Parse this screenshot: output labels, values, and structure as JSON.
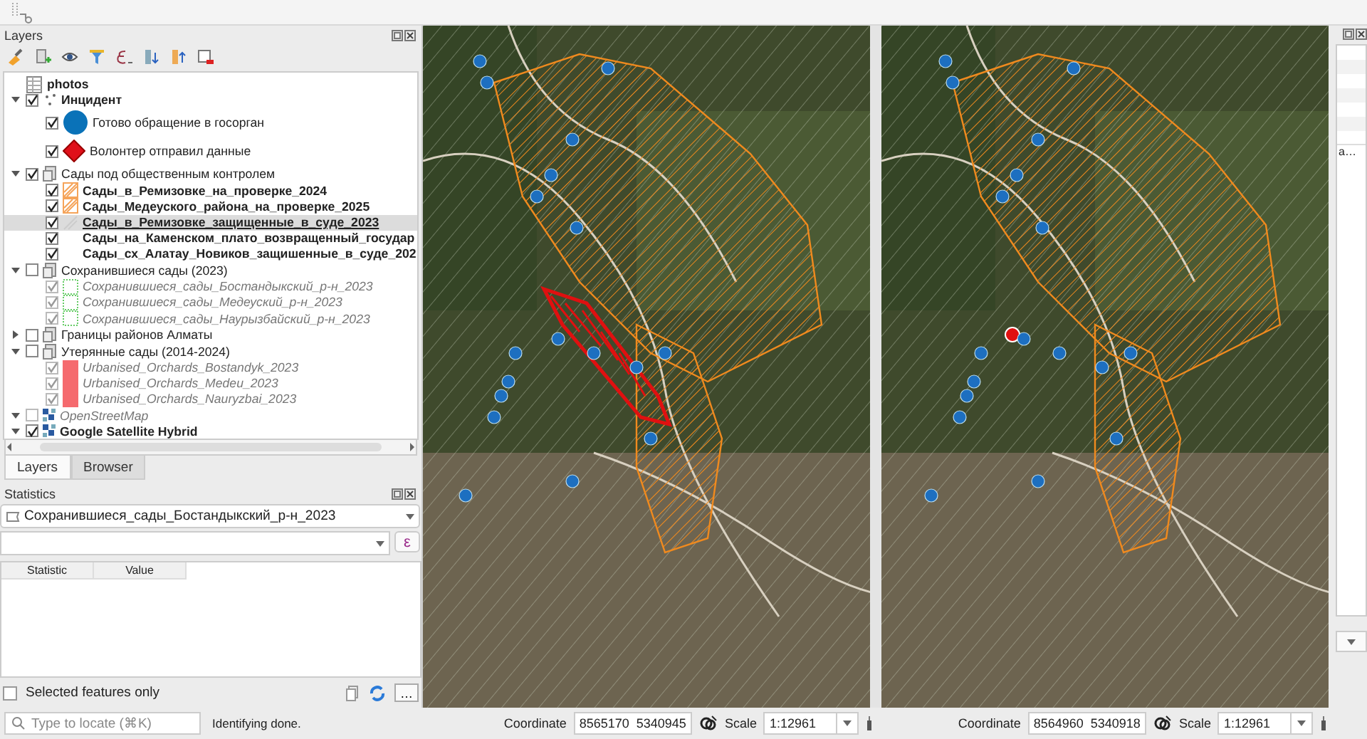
{
  "layers_panel": {
    "title": "Layers",
    "tree": [
      {
        "label": "photos",
        "kind": "table",
        "selected": false,
        "greyed": false
      },
      {
        "label": "Инцидент",
        "kind": "points",
        "checked": true,
        "expanded": true,
        "selected": false,
        "greyed": false,
        "children": [
          {
            "label": "Готово обращение в госорган",
            "kind": "circle",
            "checked": true,
            "selected": false,
            "greyed": false
          },
          {
            "label": "Волонтер отправил данные",
            "kind": "diamond",
            "checked": true,
            "selected": false,
            "greyed": false
          }
        ]
      },
      {
        "label": "Сады под общественным контролем",
        "kind": "group",
        "checked": true,
        "expanded": true,
        "selected": false,
        "greyed": false,
        "children": [
          {
            "label": "Сады_в_Ремизовке_на_проверке_2024",
            "kind": "hatched",
            "checked": true,
            "selected": false,
            "greyed": false
          },
          {
            "label": "Сады_Медеуского_района_на_проверке_2025",
            "kind": "hatched",
            "checked": true,
            "selected": false,
            "greyed": false
          },
          {
            "label": "Сады_в_Ремизовке_защищенные_в_суде_2023",
            "kind": "faint",
            "checked": true,
            "selected": true,
            "greyed": false
          },
          {
            "label": "Сады_на_Каменском_плато_возвращенный_государ",
            "kind": "blank",
            "checked": true,
            "selected": false,
            "greyed": false
          },
          {
            "label": "Сады_сх_Алатау_Новиков_защишенные_в_суде_202",
            "kind": "blank",
            "checked": true,
            "selected": false,
            "greyed": false
          }
        ]
      },
      {
        "label": "Сохранившиеся сады (2023)",
        "kind": "group",
        "checked": false,
        "expanded": true,
        "selected": false,
        "greyed": false,
        "children": [
          {
            "label": "Сохранившиеся_сады_Бостандыкский_р-н_2023",
            "kind": "outline",
            "checked": true,
            "selected": false,
            "greyed": true
          },
          {
            "label": "Сохранившиеся_сады_Медеуский_р-н_2023",
            "kind": "outline",
            "checked": true,
            "selected": false,
            "greyed": true
          },
          {
            "label": "Сохранившиеся_сады_Наурызбайский_р-н_2023",
            "kind": "outline",
            "checked": true,
            "selected": false,
            "greyed": true
          }
        ]
      },
      {
        "label": "Границы районов Алматы",
        "kind": "group",
        "checked": false,
        "expanded": false,
        "selected": false,
        "greyed": false
      },
      {
        "label": "Утерянные сады (2014-2024)",
        "kind": "group",
        "checked": false,
        "expanded": true,
        "selected": false,
        "greyed": false,
        "children": [
          {
            "label": "Urbanised_Orchards_Bostandyk_2023",
            "kind": "filled",
            "checked": true,
            "selected": false,
            "greyed": true
          },
          {
            "label": "Urbanised_Orchards_Medeu_2023",
            "kind": "filled",
            "checked": true,
            "selected": false,
            "greyed": true
          },
          {
            "label": "Urbanised_Orchards_Nauryzbai_2023",
            "kind": "filled",
            "checked": true,
            "selected": false,
            "greyed": true
          }
        ]
      },
      {
        "label": "OpenStreetMap",
        "kind": "raster",
        "checked": false,
        "expanded": true,
        "selected": false,
        "greyed": true
      },
      {
        "label": "Google Satellite Hybrid",
        "kind": "raster",
        "checked": true,
        "expanded": true,
        "selected": false,
        "greyed": false
      }
    ],
    "tabs": [
      {
        "label": "Layers",
        "selected": true
      },
      {
        "label": "Browser",
        "selected": false
      }
    ]
  },
  "statistics_panel": {
    "title": "Statistics",
    "layer": "Сохранившиеся_сады_Бостандыкский_р-н_2023",
    "expression_button": "ε",
    "columns": [
      "Statistic",
      "Value"
    ],
    "selected_only": {
      "label": "Selected features only",
      "checked": false
    },
    "more_button": "…"
  },
  "locator": {
    "placeholder": "Type to locate (⌘K)"
  },
  "status_message": "Identifying done.",
  "maps": [
    {
      "coordinate_label": "Coordinate",
      "coordinate": "8565170  5340945",
      "scale_label": "Scale",
      "scale": "1:12961"
    },
    {
      "coordinate_label": "Coordinate",
      "coordinate": "8564960  5340918",
      "scale_label": "Scale",
      "scale": "1:12961"
    }
  ],
  "right_panel": {
    "cell": "a…"
  }
}
